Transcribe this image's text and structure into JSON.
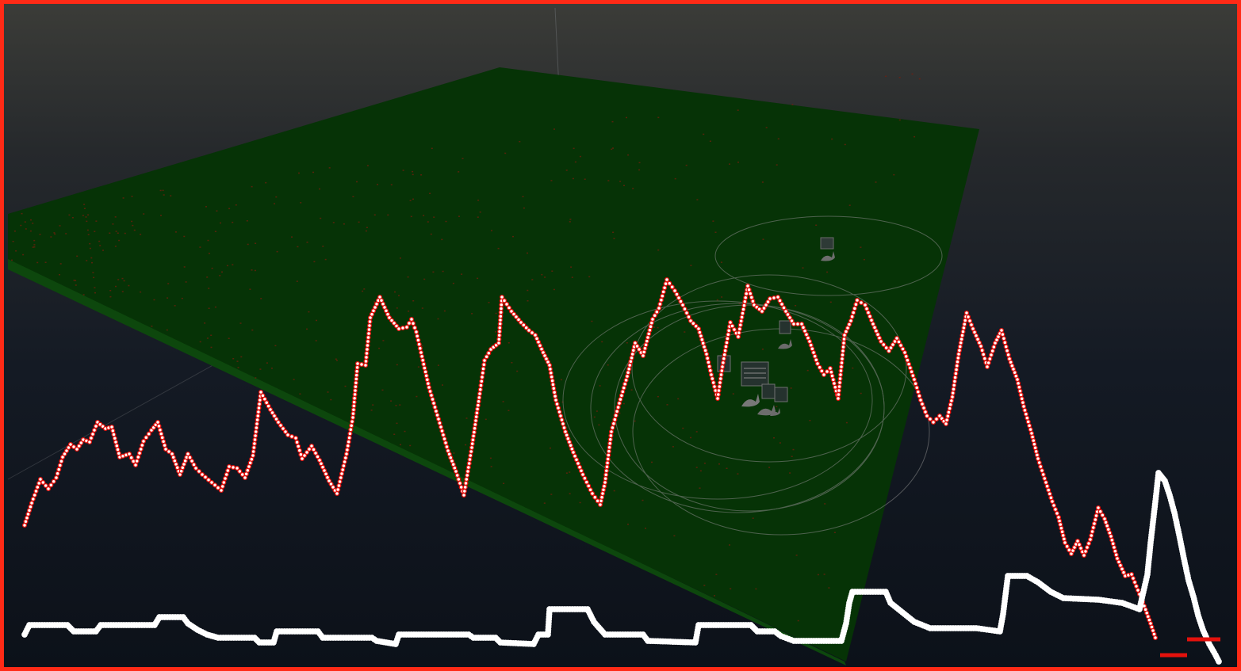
{
  "viewport": {
    "frame_color": "#ff2a16",
    "sky_top": "#3b3c38",
    "sky_bottom": "#0c1119"
  },
  "terrain": {
    "ground_color": "#063306",
    "ground_edge_color": "#0d470d",
    "speck_color": "#7a1d0d"
  },
  "entities": {
    "icons": [
      "rabbit-icon",
      "crate-icon"
    ],
    "detection_ring_color": "#8a8a8a",
    "count_rings": 6
  },
  "overlay_series": [
    {
      "id": "plot-series-upper",
      "line_color": "#ffffff",
      "marker_fill": "#ffffff",
      "marker_stroke": "#e4110c",
      "marker_radius": 2.4,
      "points_px_note": "screen-trace"
    },
    {
      "id": "plot-series-lower",
      "line_color": "#e4110c",
      "marker_fill": "#ffffff",
      "marker_stroke": "#ffffff",
      "marker_radius": 3.2
    }
  ]
}
